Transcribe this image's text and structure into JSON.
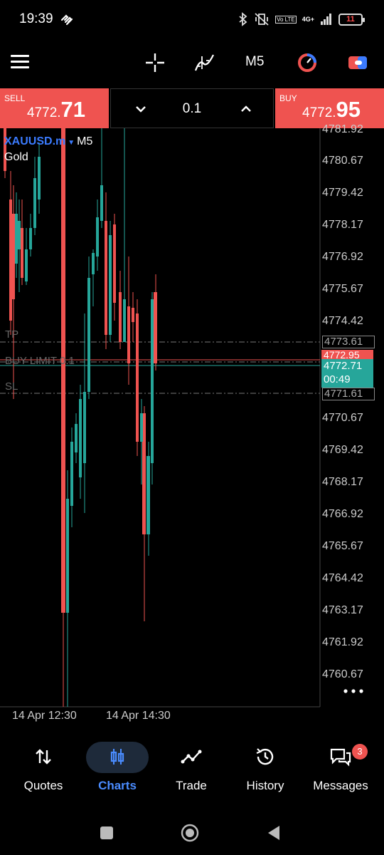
{
  "status_bar": {
    "time": "19:39",
    "network": "4G+",
    "volte": "Vo LTE",
    "battery": "11",
    "icons": [
      "bluetooth-icon",
      "vibrate-icon",
      "signal-icon",
      "battery-icon"
    ]
  },
  "toolbar": {
    "period": "M5",
    "icons": [
      "menu-icon",
      "crosshair-icon",
      "indicator-icon",
      "timeframe-icon",
      "objects-icon",
      "account-icon"
    ]
  },
  "trade": {
    "sell_label": "SELL",
    "sell_price_small": "4772.",
    "sell_price_big": "71",
    "buy_label": "BUY",
    "buy_price_small": "4772.",
    "buy_price_big": "95",
    "volume": "0.1"
  },
  "chart": {
    "symbol": "XAUUSD.m",
    "timeframe": "M5",
    "description": "Gold",
    "tp_label": "TP",
    "buy_limit_label": "BUY LIMIT 0.1",
    "sl_label": "SL",
    "tp_price": "4773.61",
    "buy_limit_price": "4772.95",
    "current_price": "4772.71",
    "countdown": "00:49",
    "sl_price": "4771.61",
    "price_ticks": [
      "4781.92",
      "4780.67",
      "4779.42",
      "4778.17",
      "4776.92",
      "4775.67",
      "4774.42",
      "4770.67",
      "4769.42",
      "4768.17",
      "4766.92",
      "4765.67",
      "4764.42",
      "4763.17",
      "4761.92",
      "4760.67"
    ],
    "time_labels": [
      "14 Apr 12:30",
      "14 Apr 14:30"
    ],
    "colors": {
      "bull": "#26a69a",
      "bear": "#ef5350",
      "level": "#777777"
    }
  },
  "nav": {
    "items": [
      {
        "label": "Quotes",
        "icon": "quotes-icon"
      },
      {
        "label": "Charts",
        "icon": "charts-icon"
      },
      {
        "label": "Trade",
        "icon": "trade-icon"
      },
      {
        "label": "History",
        "icon": "history-icon"
      },
      {
        "label": "Messages",
        "icon": "messages-icon"
      }
    ],
    "active": "Charts",
    "messages_badge": "3"
  }
}
